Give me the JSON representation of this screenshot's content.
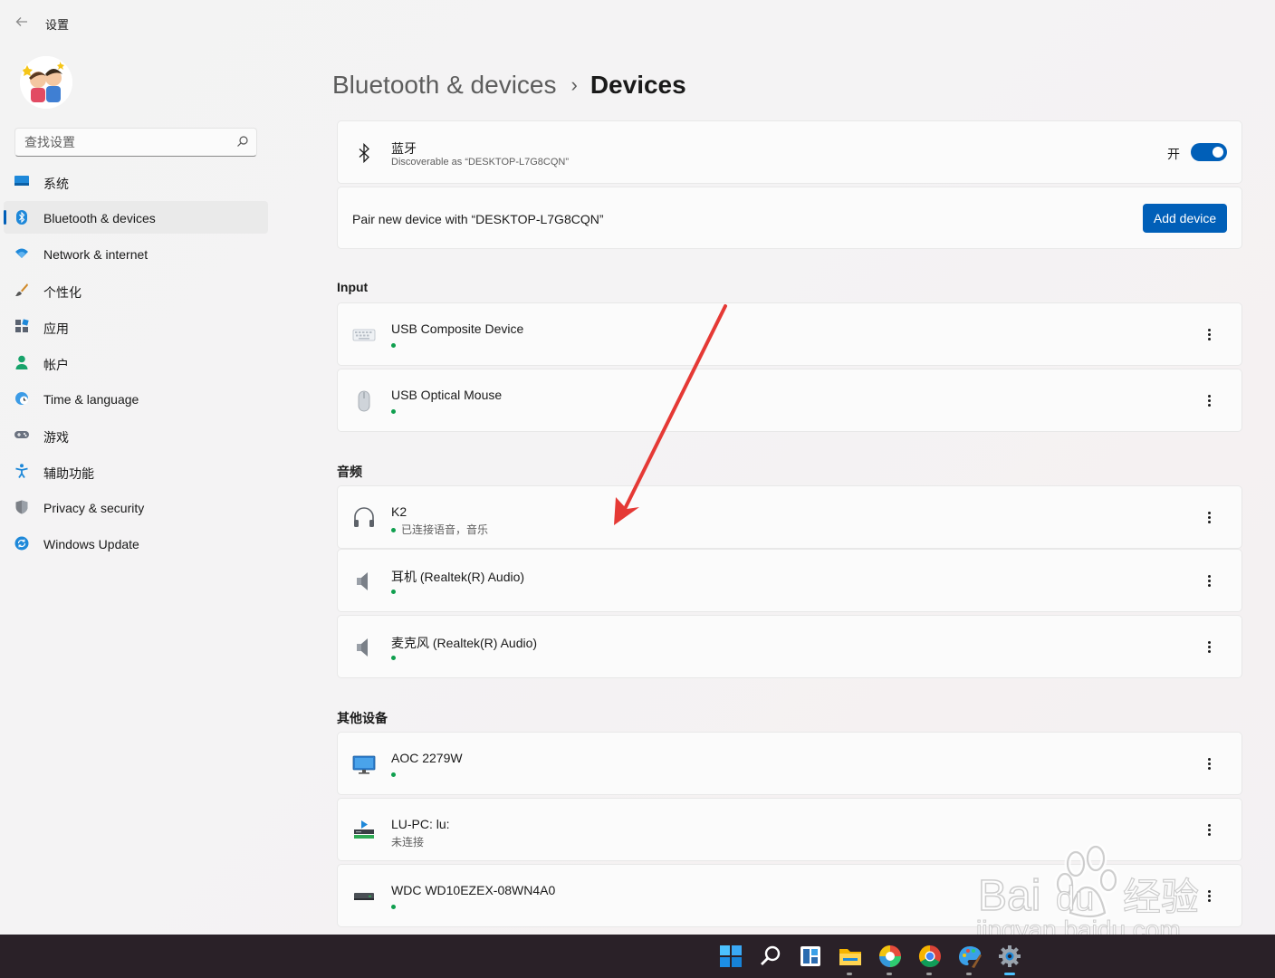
{
  "window": {
    "title": "设置",
    "back_label": "←"
  },
  "search": {
    "placeholder": "查找设置"
  },
  "sidebar": {
    "items": [
      {
        "label": "系统",
        "icon": "monitor-icon"
      },
      {
        "label": "Bluetooth & devices",
        "icon": "bluetooth-icon",
        "active": true
      },
      {
        "label": "Network & internet",
        "icon": "wifi-icon"
      },
      {
        "label": "个性化",
        "icon": "brush-icon"
      },
      {
        "label": "应用",
        "icon": "apps-icon"
      },
      {
        "label": "帐户",
        "icon": "person-icon"
      },
      {
        "label": "Time & language",
        "icon": "globe-clock-icon"
      },
      {
        "label": "游戏",
        "icon": "gamepad-icon"
      },
      {
        "label": "辅助功能",
        "icon": "accessibility-icon"
      },
      {
        "label": "Privacy & security",
        "icon": "shield-icon"
      },
      {
        "label": "Windows Update",
        "icon": "update-icon"
      }
    ]
  },
  "breadcrumb": {
    "parent": "Bluetooth & devices",
    "separator": "›",
    "current": "Devices"
  },
  "bluetooth": {
    "title": "蓝牙",
    "subtitle": "Discoverable as “DESKTOP-L7G8CQN”",
    "toggle_label": "开",
    "toggle_on": true
  },
  "pair": {
    "text": "Pair new device with “DESKTOP-L7G8CQN”",
    "button_label": "Add device"
  },
  "sections": {
    "input": {
      "title": "Input",
      "devices": [
        {
          "name": "USB Composite Device",
          "icon": "keyboard-icon",
          "status": "",
          "connected": true
        },
        {
          "name": "USB Optical Mouse",
          "icon": "mouse-icon",
          "status": "",
          "connected": true
        }
      ]
    },
    "audio": {
      "title": "音频",
      "devices": [
        {
          "name": "K2",
          "icon": "headphones-icon",
          "status": "已连接语音，音乐",
          "connected": true
        },
        {
          "name": "耳机 (Realtek(R) Audio)",
          "icon": "speaker-icon",
          "status": "",
          "connected": true
        },
        {
          "name": "麦克风 (Realtek(R) Audio)",
          "icon": "speaker-icon",
          "status": "",
          "connected": true
        }
      ]
    },
    "other": {
      "title": "其他设备",
      "devices": [
        {
          "name": "AOC 2279W",
          "icon": "display-icon",
          "status": "",
          "connected": true
        },
        {
          "name": "LU-PC: lu:",
          "icon": "media-server-icon",
          "status": "未连接",
          "connected": false
        },
        {
          "name": "WDC WD10EZEX-08WN4A0",
          "icon": "drive-icon",
          "status": "",
          "connected": true
        }
      ]
    }
  },
  "watermark": {
    "logo_text": "Bai du 经验",
    "url_text": "jingyan.baidu.com"
  },
  "taskbar": {
    "icons": [
      "start-icon",
      "search-icon",
      "widgets-icon",
      "file-explorer-icon",
      "colorful-app-icon",
      "chrome-icon",
      "paint-icon",
      "settings-icon"
    ],
    "active": "settings-icon"
  },
  "colors": {
    "accent": "#005fb8",
    "connected_dot": "#0f9f4e",
    "annotation_arrow": "#e53935",
    "taskbar": "#2a2128"
  }
}
